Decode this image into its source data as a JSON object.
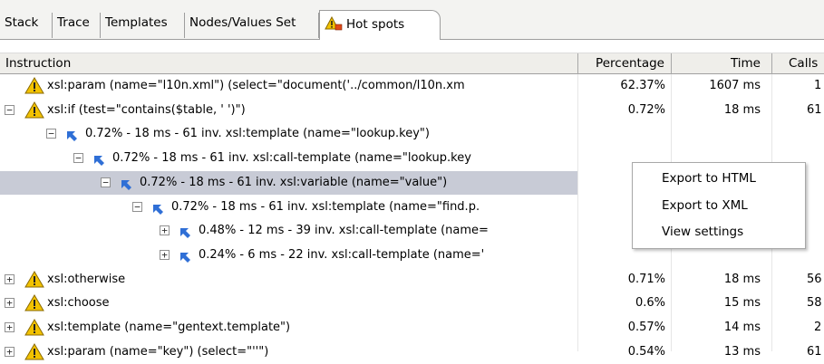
{
  "tabs": [
    {
      "label": "Stack"
    },
    {
      "label": "Trace"
    },
    {
      "label": "Templates"
    },
    {
      "label": "Nodes/Values Set"
    },
    {
      "label": "Hot spots",
      "icon": "hot-spots-icon",
      "active": true
    }
  ],
  "columns": {
    "instruction": "Instruction",
    "percentage": "Percentage",
    "time": "Time",
    "calls": "Calls"
  },
  "rows": [
    {
      "toggle": "",
      "icon": "warning-icon",
      "text": "xsl:param (name=\"l10n.xml\") (select=\"document('../common/l10n.xm",
      "percentage": "62.37%",
      "time": "1607 ms",
      "calls": "1"
    },
    {
      "toggle": "−",
      "icon": "warning-icon",
      "text": "xsl:if (test=\"contains($table, ' ')\")",
      "percentage": "0.72%",
      "time": "18 ms",
      "calls": "61"
    },
    {
      "toggle": "−",
      "icon": "back-arrow-icon",
      "text": "0.72% - 18 ms - 61 inv. xsl:template (name=\"lookup.key\")",
      "percentage": "",
      "time": "",
      "calls": ""
    },
    {
      "toggle": "−",
      "icon": "back-arrow-icon",
      "text": "0.72% - 18 ms - 61 inv. xsl:call-template (name=\"lookup.key",
      "percentage": "",
      "time": "",
      "calls": ""
    },
    {
      "toggle": "−",
      "icon": "back-arrow-icon",
      "text": "0.72% - 18 ms - 61 inv. xsl:variable (name=\"value\")",
      "percentage": "",
      "time": "",
      "calls": "",
      "selected": true
    },
    {
      "toggle": "−",
      "icon": "back-arrow-icon",
      "text": "0.72% - 18 ms - 61 inv. xsl:template (name=\"find.p.",
      "percentage": "",
      "time": "",
      "calls": ""
    },
    {
      "toggle": "+",
      "icon": "back-arrow-icon",
      "text": "0.48% - 12 ms - 39 inv. xsl:call-template (name=",
      "percentage": "",
      "time": "",
      "calls": ""
    },
    {
      "toggle": "+",
      "icon": "back-arrow-icon",
      "text": "0.24% - 6 ms - 22 inv. xsl:call-template (name='",
      "percentage": "",
      "time": "",
      "calls": ""
    },
    {
      "toggle": "+",
      "icon": "warning-icon",
      "text": "xsl:otherwise",
      "percentage": "0.71%",
      "time": "18 ms",
      "calls": "56"
    },
    {
      "toggle": "+",
      "icon": "warning-icon",
      "text": "xsl:choose",
      "percentage": "0.6%",
      "time": "15 ms",
      "calls": "58"
    },
    {
      "toggle": "+",
      "icon": "warning-icon",
      "text": "xsl:template (name=\"gentext.template\")",
      "percentage": "0.57%",
      "time": "14 ms",
      "calls": "2"
    },
    {
      "toggle": "+",
      "icon": "warning-icon",
      "text": "xsl:param (name=\"key\") (select=\"''\")",
      "percentage": "0.54%",
      "time": "13 ms",
      "calls": "61"
    }
  ],
  "context_menu": {
    "items": [
      {
        "label": "Export to HTML"
      },
      {
        "label": "Export to XML"
      },
      {
        "label": "View settings"
      }
    ]
  },
  "colors": {
    "warning": "#f2c200",
    "arrow": "#2f6fd6",
    "selection": "#c8cbd6"
  }
}
